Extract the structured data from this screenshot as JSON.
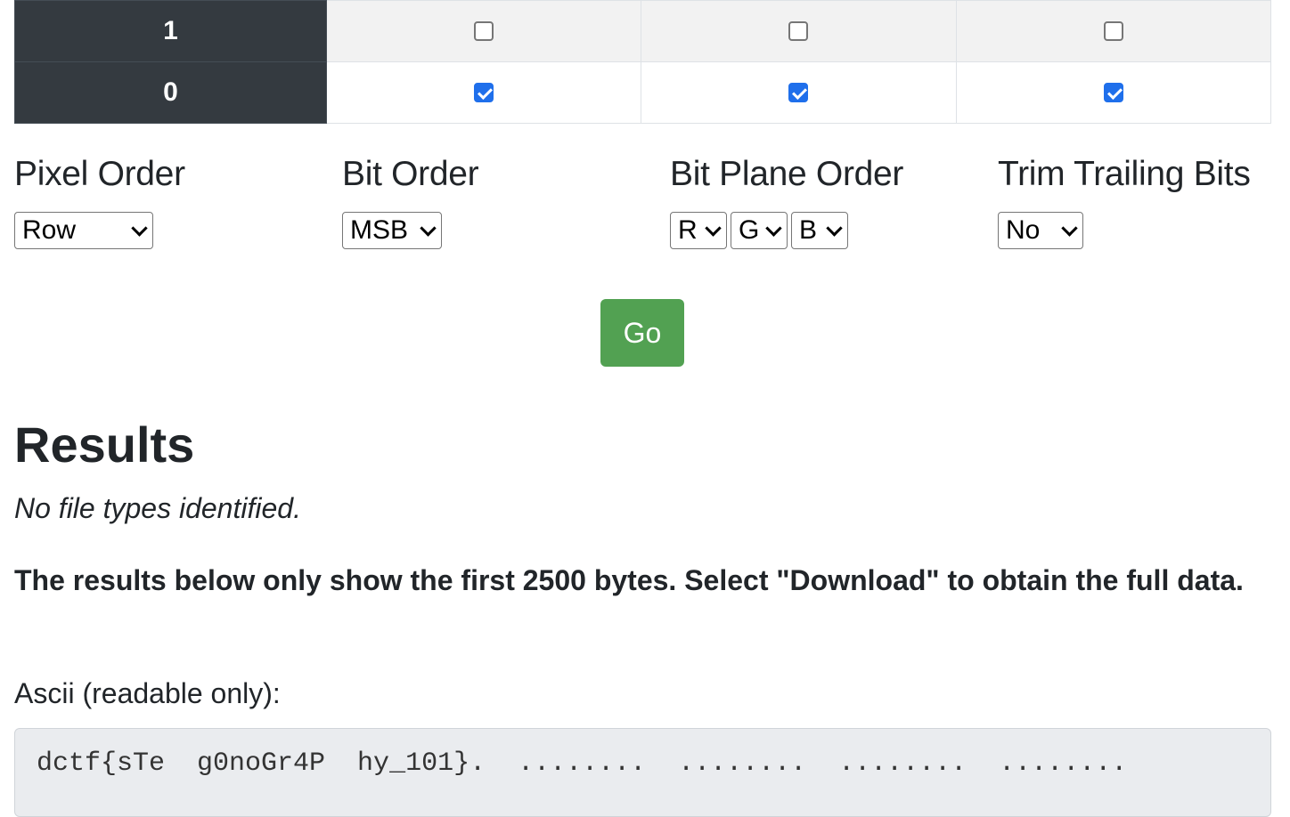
{
  "bit_table": {
    "rows": [
      {
        "label": "1",
        "checked": [
          false,
          false,
          false
        ]
      },
      {
        "label": "0",
        "checked": [
          true,
          true,
          true
        ]
      }
    ]
  },
  "options": {
    "pixel_order": {
      "label": "Pixel Order",
      "value": "Row"
    },
    "bit_order": {
      "label": "Bit Order",
      "value": "MSB"
    },
    "bit_plane_order": {
      "label": "Bit Plane Order",
      "values": [
        "R",
        "G",
        "B"
      ]
    },
    "trim_trailing_bits": {
      "label": "Trim Trailing Bits",
      "value": "No"
    }
  },
  "go_button": {
    "label": "Go",
    "color": "#52a152"
  },
  "results": {
    "title": "Results",
    "no_types": "No file types identified.",
    "notice": "The results below only show the first 2500 bytes. Select \"Download\" to obtain the full data.",
    "ascii_label": "Ascii (readable only):",
    "ascii_text": "dctf{sTe  g0noGr4P  hy_101}.  ........  ........  ........  ........"
  },
  "colors": {
    "header_dark": "#343a40",
    "checkbox_blue": "#1f6feb"
  }
}
